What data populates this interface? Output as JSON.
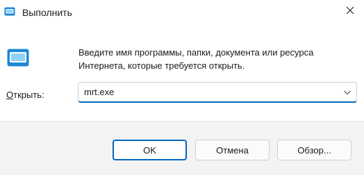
{
  "window": {
    "title": "Выполнить",
    "app_icon": "run-icon",
    "close_icon": "close-icon"
  },
  "main": {
    "icon": "run-icon",
    "description": "Введите имя программы, папки, документа или ресурса\nИнтернета, которые требуется открыть.",
    "open_label_underlined": "О",
    "open_label_rest": "ткрыть:",
    "input_value": "mrt.exe",
    "dropdown_icon": "chevron-down-icon"
  },
  "buttons": {
    "ok": "OK",
    "cancel": "Отмена",
    "browse": "Обзор..."
  },
  "colors": {
    "accent": "#0067c0",
    "footer_background": "#f3f3f3"
  }
}
